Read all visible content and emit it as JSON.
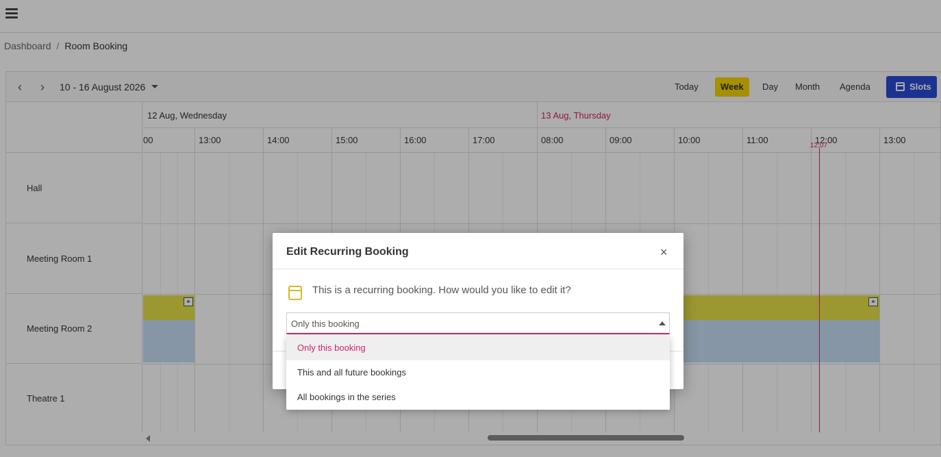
{
  "topbar": {
    "menu_icon": "hamburger-menu-icon"
  },
  "breadcrumb": {
    "home": "Dashboard",
    "separator": "/",
    "current": "Room Booking"
  },
  "toolbar": {
    "date_range": "10 - 16 August 2026",
    "views": [
      "Today",
      "Week",
      "Day",
      "Month",
      "Agenda"
    ],
    "active_view": "Week",
    "slots_label": "Slots"
  },
  "scheduler": {
    "dates": [
      {
        "label": "12 Aug, Wednesday",
        "today": false
      },
      {
        "label": "13 Aug, Thursday",
        "today": true
      }
    ],
    "times": [
      "00",
      "13:00",
      "14:00",
      "15:00",
      "16:00",
      "17:00",
      "08:00",
      "09:00",
      "10:00",
      "11:00",
      "12:00",
      "13:00"
    ],
    "resources": [
      "Hall",
      "Meeting Room 1",
      "Meeting Room 2",
      "Theatre 1"
    ],
    "current_time": "12:07"
  },
  "dialog": {
    "title": "Edit Recurring Booking",
    "close": "×",
    "message": "This is a recurring booking. How would you like to edit it?",
    "selected": "Only this booking",
    "options": [
      "Only this booking",
      "This and all future bookings",
      "All bookings in the series"
    ]
  },
  "colors": {
    "accent": "#d0246b",
    "active_view": "#f5d300",
    "slots_button": "#2a4bd7",
    "booking_top": "#e5e04a",
    "booking_bottom": "#c8def5"
  }
}
